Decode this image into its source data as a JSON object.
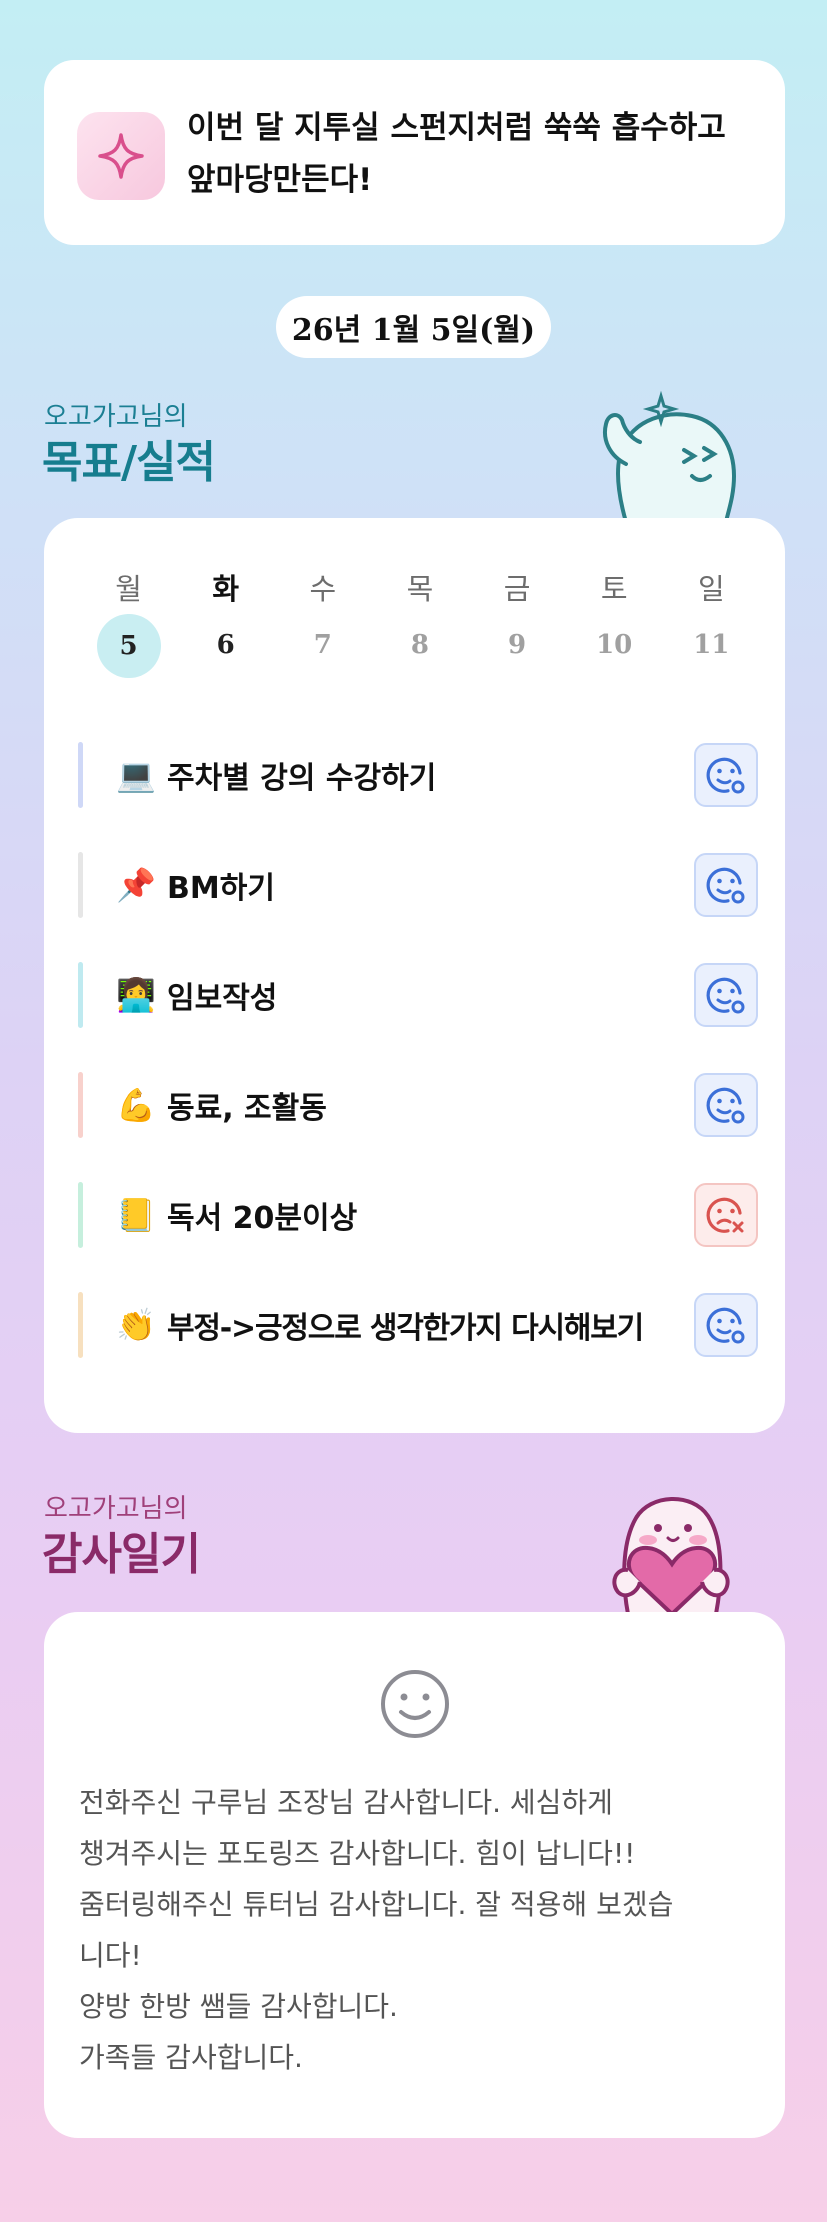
{
  "motto": {
    "line1": "이번 달 지투실 스펀지처럼 쑥쑥 흡수하고",
    "line2": "앞마당만든다!"
  },
  "date": "26년 1월 5일(월)",
  "goals_section": {
    "subtitle": "오고가고님의",
    "title": "목표/실적"
  },
  "week": {
    "days": [
      "월",
      "화",
      "수",
      "목",
      "금",
      "토",
      "일"
    ],
    "dates": [
      "5",
      "6",
      "7",
      "8",
      "9",
      "10",
      "11"
    ],
    "selected_index": 0
  },
  "goals": [
    {
      "emoji": "💻",
      "label": "주차별 강의 수강하기",
      "bar_color": "#cfd8f7",
      "status": "done"
    },
    {
      "emoji": "📌",
      "label": "BM하기",
      "bar_color": "#e6e6e6",
      "status": "done"
    },
    {
      "emoji": "👩‍💻",
      "label": "임보작성",
      "bar_color": "#bfeaf0",
      "status": "done"
    },
    {
      "emoji": "💪",
      "label": "동료, 조활동",
      "bar_color": "#f8d1cc",
      "status": "done"
    },
    {
      "emoji": "📒",
      "label": "독서 20분이상",
      "bar_color": "#c6efdd",
      "status": "missed"
    },
    {
      "emoji": "👏",
      "label": "부정->긍정으로 생각한가지 다시해보기",
      "bar_color": "#f7e0bf",
      "status": "done"
    }
  ],
  "thanks_section": {
    "subtitle": "오고가고님의",
    "title": "감사일기"
  },
  "thanks": {
    "icon": "smile-icon",
    "lines": [
      "전화주신 구루님 조장님 감사합니다. 세심하게",
      "챙겨주시는 포도링즈 감사합니다. 힘이 납니다!!",
      "줌터링해주신 튜터님 감사합니다. 잘 적용해 보겠습",
      "니다!",
      "양방 한방 쌤들 감사합니다.",
      "가족들 감사합니다."
    ]
  },
  "colors": {
    "accent_teal": "#167d8e",
    "accent_pink": "#8a2a68",
    "status_ok": "#3b6fd8",
    "status_bad": "#d9534f"
  }
}
